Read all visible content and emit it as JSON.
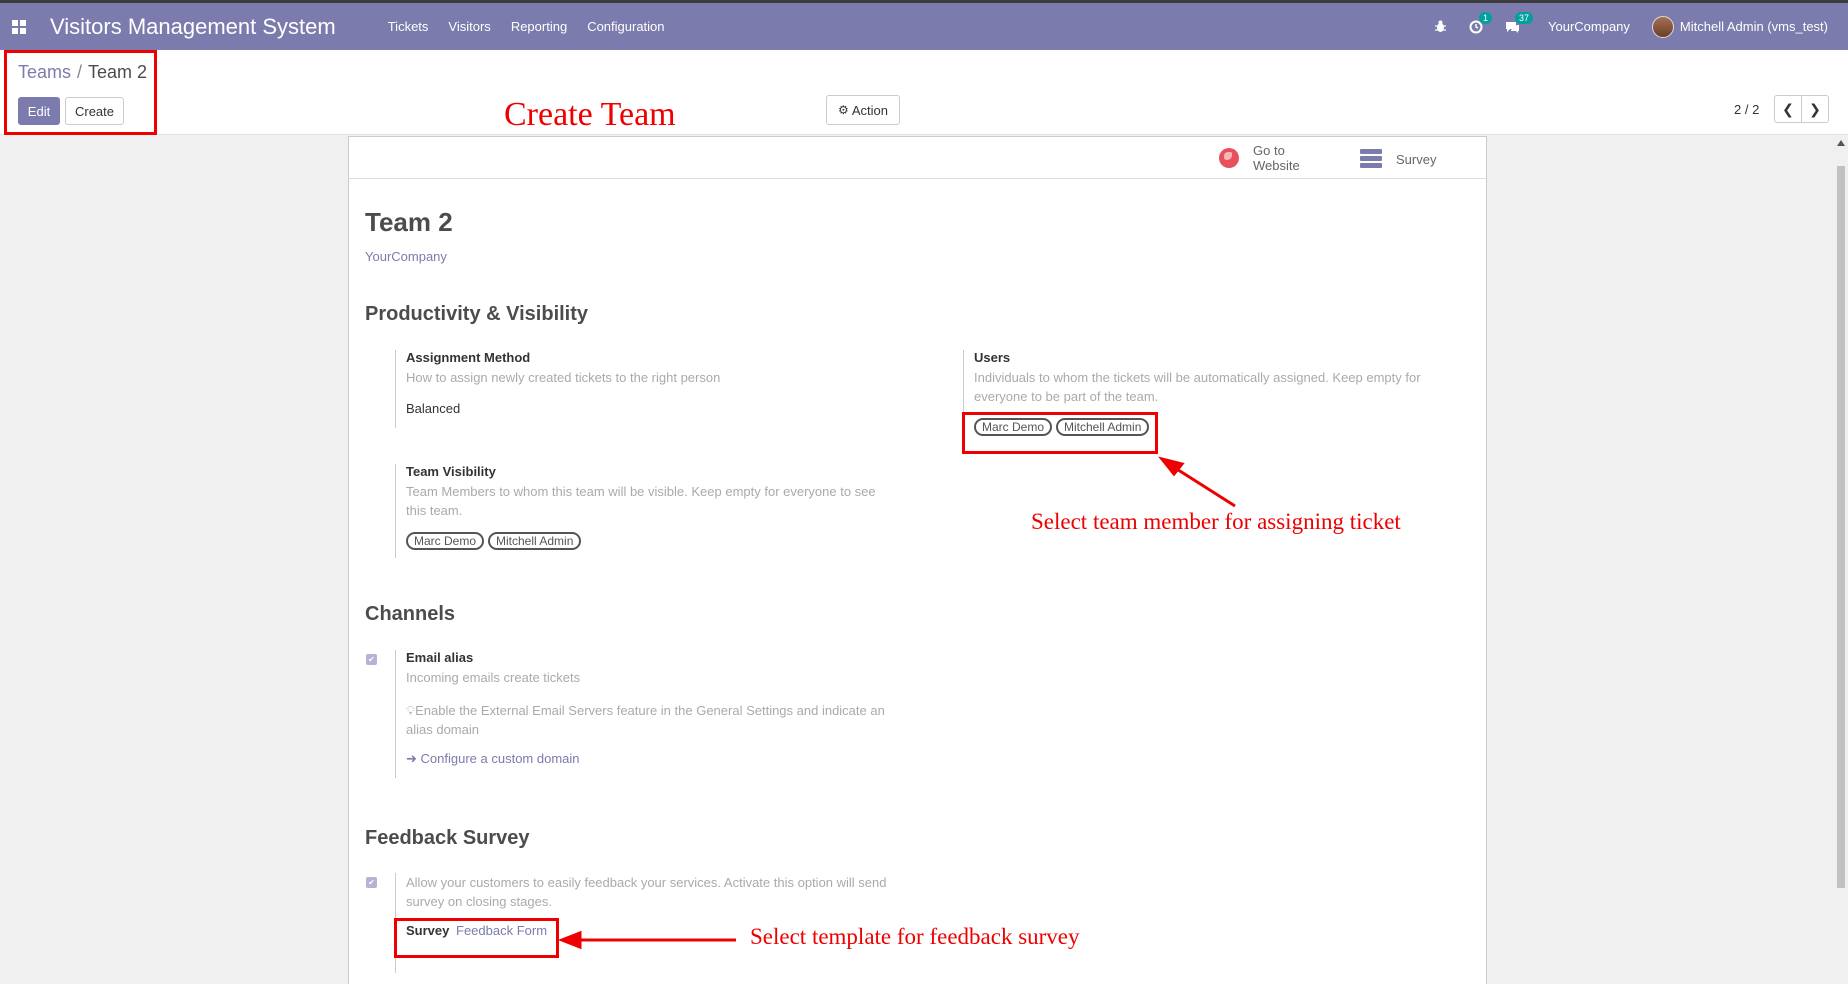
{
  "navbar": {
    "app_title": "Visitors Management System",
    "menu": [
      "Tickets",
      "Visitors",
      "Reporting",
      "Configuration"
    ],
    "chat_badge": "1",
    "message_badge": "37",
    "company": "YourCompany",
    "user": "Mitchell Admin (vms_test)"
  },
  "breadcrumb": {
    "parent": "Teams",
    "separator": "/",
    "current": "Team 2"
  },
  "buttons": {
    "edit": "Edit",
    "create": "Create",
    "action": "Action"
  },
  "pager": {
    "value": "2 / 2"
  },
  "annotations": {
    "create_team": "Create Team",
    "select_member": "Select team member for assigning ticket",
    "select_template": "Select template for feedback survey"
  },
  "smart_buttons": {
    "website_line1": "Go to",
    "website_line2": "Website",
    "survey": "Survey"
  },
  "record": {
    "name": "Team 2",
    "company": "YourCompany"
  },
  "productivity": {
    "heading": "Productivity & Visibility",
    "assignment_label": "Assignment Method",
    "assignment_help": "How to assign newly created tickets to the right person",
    "assignment_value": "Balanced",
    "users_label": "Users",
    "users_help": "Individuals to whom the tickets will be automatically assigned. Keep empty for everyone to be part of the team.",
    "users_tags": [
      "Marc Demo",
      "Mitchell Admin"
    ],
    "visibility_label": "Team Visibility",
    "visibility_help": "Team Members to whom this team will be visible. Keep empty for everyone to see this team.",
    "visibility_tags": [
      "Marc Demo",
      "Mitchell Admin"
    ]
  },
  "channels": {
    "heading": "Channels",
    "email_label": "Email alias",
    "email_help": "Incoming emails create tickets",
    "email_hint": "Enable the External Email Servers feature in the General Settings and indicate an alias domain",
    "configure_link": "Configure a custom domain"
  },
  "feedback": {
    "heading": "Feedback Survey",
    "help": "Allow your customers to easily feedback your services. Activate this option will send survey on closing stages.",
    "survey_label": "Survey",
    "survey_value": "Feedback Form"
  }
}
